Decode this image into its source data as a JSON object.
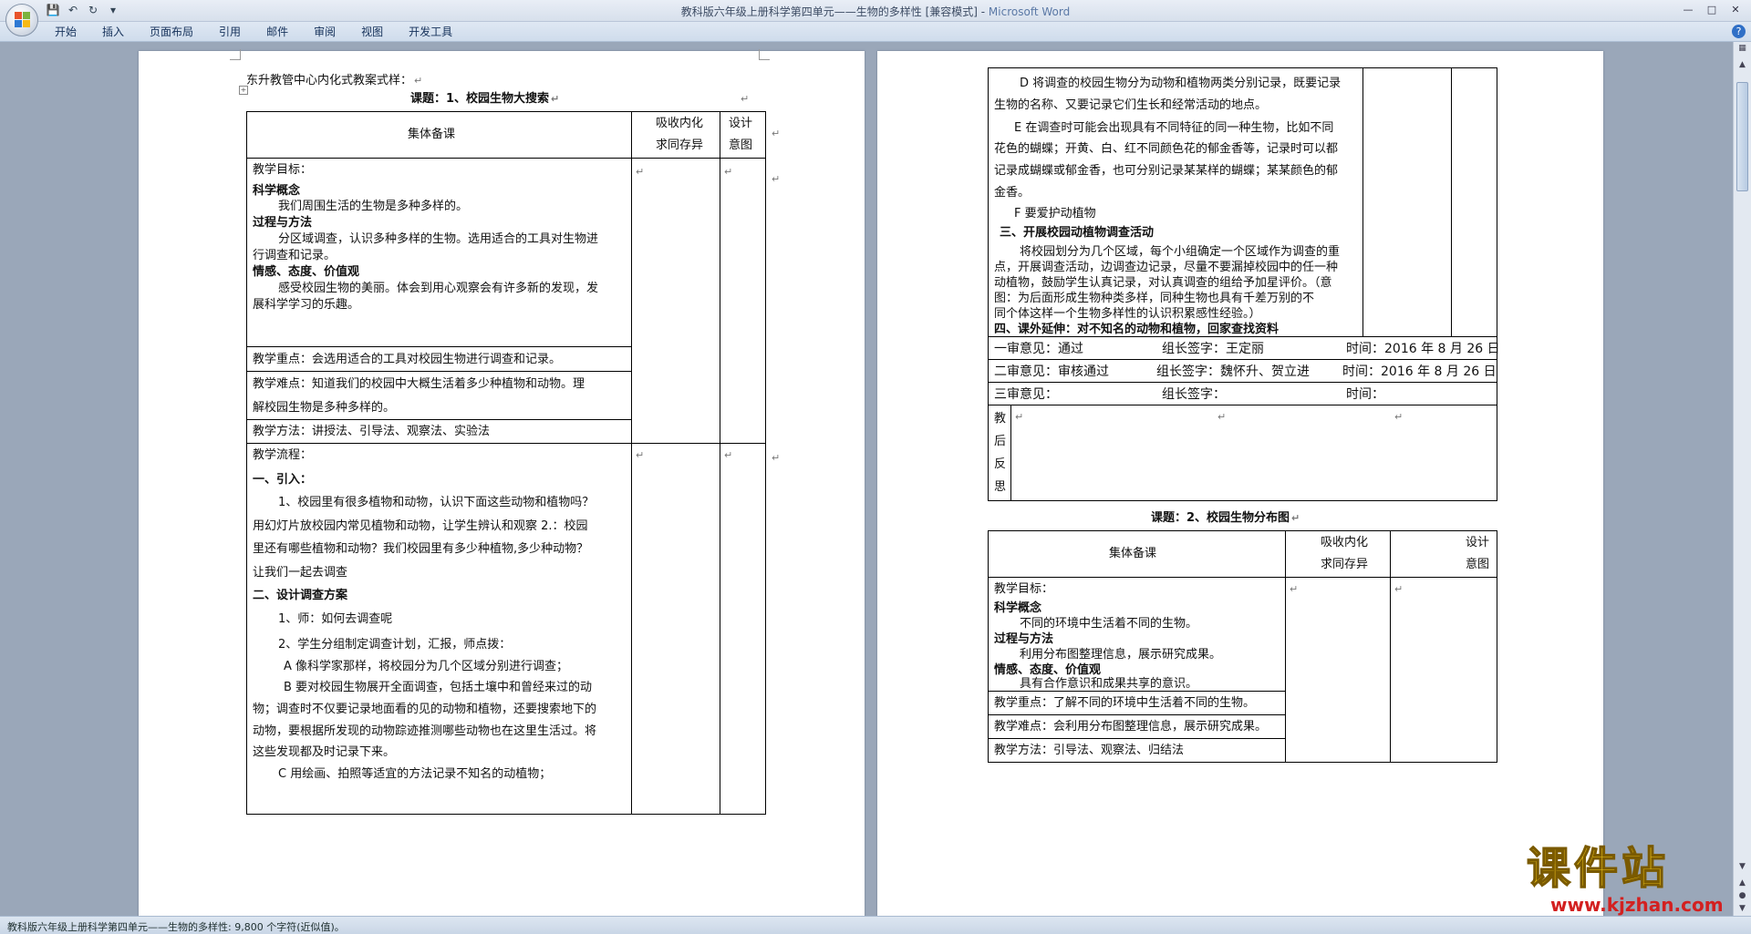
{
  "window": {
    "title_doc": "教科版六年级上册科学第四单元——生物的多样性 [兼容模式] - ",
    "title_app": "Microsoft Word"
  },
  "ribbon": {
    "tabs": [
      "开始",
      "插入",
      "页面布局",
      "引用",
      "邮件",
      "审阅",
      "视图",
      "开发工具"
    ]
  },
  "status_bar": {
    "text": "教科版六年级上册科学第四单元——生物的多样性: 9,800 个字符(近似值)。"
  },
  "watermark": {
    "brand": "课件站",
    "url": "www.kjzhan.com"
  },
  "left_page": {
    "header_line": "东升教管中心内化式教案式样：",
    "lesson_title": "课题：1、校园生物大搜索",
    "table": {
      "head_col1": "集体备课",
      "head_col2_line1": "吸收内化",
      "head_col2_line2": "求同存异",
      "head_col3_line1": "设计",
      "head_col3_line2": "意图",
      "objectives_label": "教学目标：",
      "sci_concept": "科学概念",
      "sci_concept_text": "我们周围生活的生物是多种多样的。",
      "process": "过程与方法",
      "process_text1": "分区域调查，认识多种多样的生物。选用适合的工具对生物进",
      "process_text2": "行调查和记录。",
      "emotion": "情感、态度、价值观",
      "emotion_text1": "感受校园生物的美丽。体会到用心观察会有许多新的发现，发",
      "emotion_text2": "展科学学习的乐趣。",
      "key_point": "教学重点：会选用适合的工具对校园生物进行调查和记录。",
      "difficulty1": "教学难点：知道我们的校园中大概生活着多少种植物和动物。理",
      "difficulty2": "解校园生物是多种多样的。",
      "methods": "教学方法：讲授法、引导法、观察法、实验法",
      "flow_label": "教学流程：",
      "intro": "一、引入：",
      "intro_p1": "1、校园里有很多植物和动物，认识下面这些动物和植物吗？",
      "intro_p2": "用幻灯片放校园内常见植物和动物，让学生辨认和观察 2.：校园",
      "intro_p3": "里还有哪些植物和动物？我们校园里有多少种植物,多少种动物？",
      "intro_p4": "让我们一起去调查",
      "design": "二、设计调查方案",
      "design_p1": "1、师：如何去调查呢",
      "design_p2": "2、学生分组制定调查计划，汇报，师点拨：",
      "design_a": "A 像科学家那样，将校园分为几个区域分别进行调查；",
      "design_b1": "B 要对校园生物展开全面调查，包括土壤中和曾经来过的动",
      "design_b2": "物；调查时不仅要记录地面看的见的动物和植物，还要搜索地下的",
      "design_b3": "动物，要根据所发现的动物踪迹推测哪些动物也在这里生活过。将",
      "design_b4": "这些发现都及时记录下来。",
      "design_c": "C 用绘画、拍照等适宜的方法记录不知名的动植物；"
    }
  },
  "right_page": {
    "top_table": {
      "d1": "D 将调查的校园生物分为动物和植物两类分别记录，既要记录",
      "d2": "生物的名称、又要记录它们生长和经常活动的地点。",
      "e1": "E 在调查时可能会出现具有不同特征的同一种生物，比如不同",
      "e2": "花色的蝴蝶；开黄、白、红不同颜色花的郁金香等，记录时可以都",
      "e3": "记录成蝴蝶或郁金香，也可分别记录某某样的蝴蝶；某某颜色的郁",
      "e4": "金香。",
      "f": "F 要爱护动植物",
      "s3": "三、开展校园动植物调查活动",
      "s3_1": "将校园划分为几个区域，每个小组确定一个区域作为调查的重",
      "s3_2": "点，开展调查活动，边调查边记录，尽量不要漏掉校园中的任一种",
      "s3_3": "动植物，鼓励学生认真记录，对认真调查的组给予加星评价。（意",
      "s3_4": "图：为后面形成生物种类多样，同种生物也具有千差万别的不",
      "s3_5": "同个体这样一个生物多样性的认识积累感性经验。）",
      "s4": "四、课外延伸：对不知名的动物和植物，回家查找资料"
    },
    "reviews": [
      {
        "opinion": "一审意见：通过",
        "signer": "组长签字：王定丽",
        "time": "时间：2016 年 8 月 26 日"
      },
      {
        "opinion": "二审意见：审核通过",
        "signer": "组长签字：魏怀升、贺立进",
        "time": "时间：2016 年 8 月 26 日"
      },
      {
        "opinion": "三审意见：",
        "signer": "组长签字：",
        "time": "时间："
      }
    ],
    "reflection_chars": [
      "教",
      "后",
      "反",
      "思"
    ],
    "lesson2_title": "课题：2、校园生物分布图",
    "table2": {
      "head_col1": "集体备课",
      "head_col2_line1": "吸收内化",
      "head_col2_line2": "求同存异",
      "head_col3_line1": "设计",
      "head_col3_line2": "意图",
      "objectives_label": "教学目标：",
      "sci_concept": "科学概念",
      "sci_concept_text": "不同的环境中生活着不同的生物。",
      "process": "过程与方法",
      "process_text": "利用分布图整理信息，展示研究成果。",
      "emotion": "情感、态度、价值观",
      "emotion_text": "具有合作意识和成果共享的意识。",
      "key_point": "教学重点：了解不同的环境中生活着不同的生物。",
      "difficulty": "教学难点：会利用分布图整理信息，展示研究成果。",
      "methods": "教学方法：引导法、观察法、归结法"
    }
  },
  "colors": {
    "page_bg": "#ffffff",
    "workspace_bg": "#9aa7b9",
    "ribbon_bg": "#dfe8f3",
    "watermark_yellow": "#f0c41a",
    "watermark_red": "#d32020"
  }
}
